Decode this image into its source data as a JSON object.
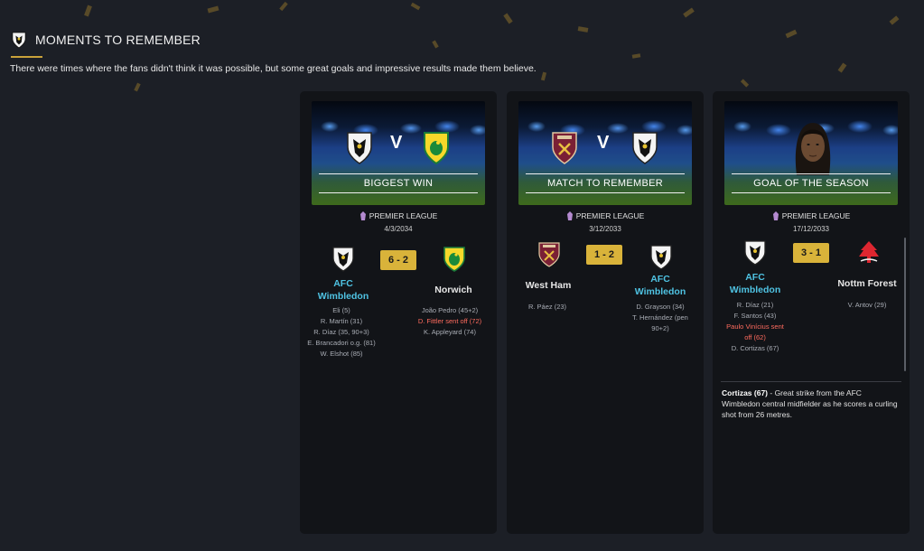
{
  "header": {
    "title": "MOMENTS TO REMEMBER",
    "subtitle": "There were times where the fans didn't think it was possible, but some great goals and impressive results made them believe."
  },
  "colors": {
    "accent": "#c9a23a",
    "score_bg": "#d9b33a",
    "highlight_team": "#4fc3e3",
    "sent_off": "#ff6b5e",
    "card_bg": "#121418"
  },
  "cards": [
    {
      "banner_label": "BIGGEST WIN",
      "banner_vs": "V",
      "competition": "PREMIER LEAGUE",
      "date": "4/3/2034",
      "score": "6 - 2",
      "home": {
        "name_line1": "AFC",
        "name_line2": "Wimbledon",
        "crest": "afc-wimbledon-crest-icon",
        "scorers": [
          "Eli (5)",
          "R. Martín (31)",
          "R. Díaz (35, 90+3)",
          "E. Brancadori o.g. (81)",
          "W. Elshot (85)"
        ]
      },
      "away": {
        "name": "Norwich",
        "crest": "norwich-crest-icon",
        "scorers": [
          "João Pedro (45+2)",
          "D. Fittler sent off (72)",
          "K. Appleyard (74)"
        ]
      }
    },
    {
      "banner_label": "MATCH TO REMEMBER",
      "banner_vs": "V",
      "competition": "PREMIER LEAGUE",
      "date": "3/12/2033",
      "score": "1 - 2",
      "home": {
        "name": "West Ham",
        "crest": "west-ham-crest-icon",
        "scorers": [
          "R. Páez (23)"
        ]
      },
      "away": {
        "name_line1": "AFC",
        "name_line2": "Wimbledon",
        "crest": "afc-wimbledon-crest-icon",
        "scorers": [
          "D. Grayson (34)",
          "T. Hernández (pen",
          "90+2)"
        ]
      }
    },
    {
      "banner_label": "GOAL OF THE SEASON",
      "competition": "PREMIER LEAGUE",
      "date": "17/12/2033",
      "score": "3 - 1",
      "home": {
        "name_line1": "AFC",
        "name_line2": "Wimbledon",
        "crest": "afc-wimbledon-crest-icon",
        "scorers": [
          "R. Díaz (21)",
          "F. Santos (43)",
          "Paulo Vinícius sent",
          "off (62)",
          "D. Cortizas (67)"
        ]
      },
      "away": {
        "name": "Nottm Forest",
        "crest": "nottm-forest-crest-icon",
        "scorers": [
          "V. Antov (29)"
        ]
      },
      "description_bold": "Cortizas (67)",
      "description": " - Great strike from the AFC Wimbledon central midfielder as he scores a curling shot from 26 metres."
    }
  ]
}
